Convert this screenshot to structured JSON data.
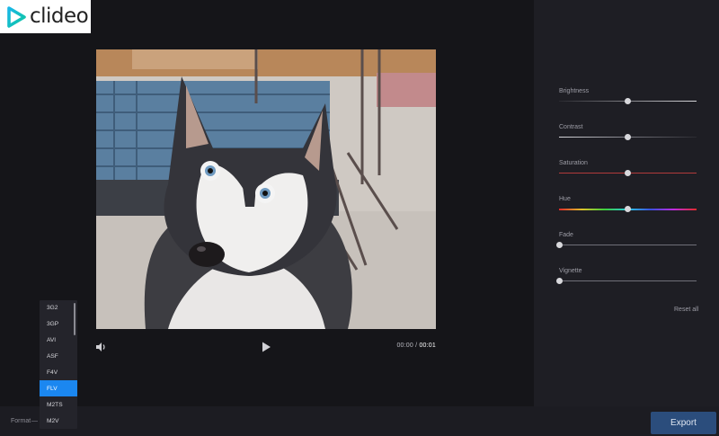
{
  "brand": {
    "name": "clideo"
  },
  "player": {
    "current_time": "00:00",
    "separator": "/",
    "total_time": "00:01",
    "volume_icon": "speaker-icon",
    "play_icon": "play-icon"
  },
  "adjustments": {
    "sliders": [
      {
        "label": "Brightness",
        "value": 0.5,
        "track": "#9a9aa2"
      },
      {
        "label": "Contrast",
        "value": 0.5,
        "track": "#9a9aa2"
      },
      {
        "label": "Saturation",
        "value": 0.5,
        "track": "#b23b3b"
      },
      {
        "label": "Hue",
        "value": 0.5,
        "track": "rainbow"
      },
      {
        "label": "Fade",
        "value": 0.0,
        "track": "#6f6f78"
      },
      {
        "label": "Vignette",
        "value": 0.0,
        "track": "#6f6f78"
      }
    ],
    "reset_label": "Reset all"
  },
  "format": {
    "label": "Format",
    "dash": "—",
    "options": [
      "3G2",
      "3GP",
      "AVI",
      "ASF",
      "F4V",
      "FLV",
      "M2TS",
      "M2V"
    ],
    "selected": "FLV"
  },
  "export": {
    "label": "Export"
  },
  "colors": {
    "accent": "#1b87f0",
    "export_bg": "#2b4d7c"
  }
}
